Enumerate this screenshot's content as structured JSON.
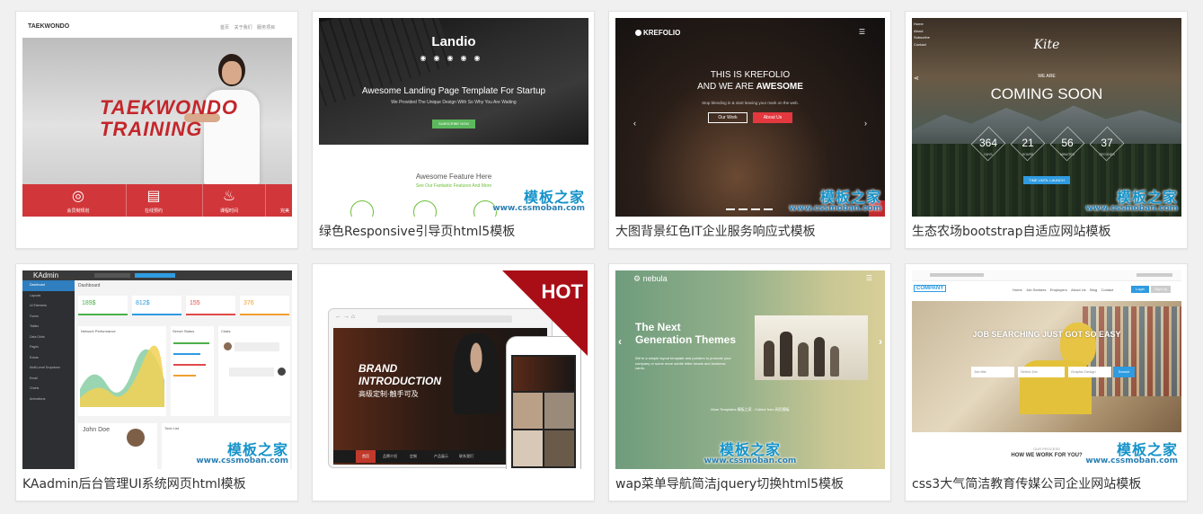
{
  "watermark": {
    "line1": "模板之家",
    "line2": "www.cssmoban.com"
  },
  "cards": [
    {
      "caption": "",
      "preview": {
        "brand": "TAEKWONDO",
        "nav": [
          "首页",
          "关于我们",
          "服务项目"
        ],
        "headline1": "TAEKWONDO",
        "headline2": "TRAINING",
        "feature_labels": [
          "会员制规划",
          "在线预约",
          "课程时间",
          "完美"
        ]
      }
    },
    {
      "caption": "绿色Responsive引导页html5模板",
      "preview": {
        "logo": "Landio",
        "headline": "Awesome Landing Page Template For Startup",
        "subline": "We Provided The Unique Design With So Why You Are Waiting",
        "cta": "SUBSCRIBE NOW",
        "feature_title": "Awesome Feature Here",
        "feature_sub": "See Our Fantastic Features And More"
      }
    },
    {
      "caption": "大图背景红色IT企业服务响应式模板",
      "preview": {
        "logo": "KREFOLIO",
        "line1": "THIS IS KREFOLIO",
        "line2_a": "AND WE ARE ",
        "line2_b": "AWESOME",
        "sub": "Stop blending in & start leaving your mark on the web.",
        "btn1": "Our Work",
        "btn2": "About Us"
      }
    },
    {
      "caption": "生态农场bootstrap自适应网站模板",
      "preview": {
        "logo": "Kite",
        "menu": [
          "Home",
          "About",
          "Subscribe",
          "Contact"
        ],
        "we_are": "WE ARE",
        "coming": "COMING SOON",
        "countdown": [
          {
            "value": "364",
            "unit": "DAYS"
          },
          {
            "value": "21",
            "unit": "HOURS"
          },
          {
            "value": "56",
            "unit": "MINUTES"
          },
          {
            "value": "37",
            "unit": "SECONDS"
          }
        ],
        "cta": "TIME UNTIL LAUNCH"
      }
    },
    {
      "caption": "KAadmin后台管理UI系统网页html模板",
      "preview": {
        "brand": "KAdmin",
        "page": "Dashboard",
        "side_items": [
          "Dashboard",
          "Layouts",
          "UI Elements",
          "Forms",
          "Tables",
          "Data Grids",
          "Pages",
          "Extras",
          "Multi-Level Dropdown",
          "Email",
          "Charts",
          "Animations"
        ],
        "stats": [
          "189$",
          "812$",
          "155",
          "376"
        ],
        "profile_name": "John Doe",
        "chart_title": "Network Performance",
        "server_title": "Server Status",
        "chat_title": "Chats",
        "todo_title": "Todo List"
      }
    },
    {
      "caption": "",
      "hot": "HOT",
      "preview": {
        "brand1": "BRAND",
        "brand2": "INTRODUCTION",
        "brand_cn": "高级定制·触手可及",
        "nav": [
          "首页",
          "品牌介绍",
          "定制",
          "产品展示",
          "联系我们"
        ]
      }
    },
    {
      "caption": "wap菜单导航简洁jquery切换html5模板",
      "preview": {
        "logo": "nebula",
        "headline1": "The Next",
        "headline2": "Generation Themes",
        "sub": "We're a simple layout template and pointers to promote your company or some more subtle letter heads and business cards.",
        "footer": "More Templates 模板之家 - Collect from 网页模板"
      }
    },
    {
      "caption": "css3大气简洁教育传媒公司企业网站模板",
      "preview": {
        "logo": "COMPANY",
        "nav": [
          "Home",
          "Job Seekers",
          "Employers",
          "About Us",
          "Blog",
          "Contact"
        ],
        "login": "Login",
        "signup": "Sign Up",
        "headline": "JOB SEARCHING JUST GOT SO EASY",
        "search_fields": [
          "Job title",
          "Select Job",
          "Graphic Design"
        ],
        "search_btn": "Search",
        "how_small": "OUR PROCESS",
        "how": "HOW WE WORK FOR YOU?"
      }
    }
  ]
}
